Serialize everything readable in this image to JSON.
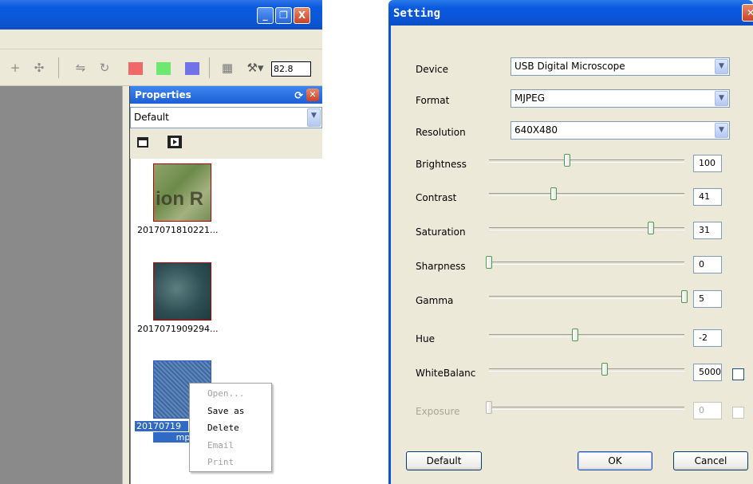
{
  "left_window": {
    "caption_buttons": {
      "minimize": "_",
      "restore": "❐",
      "close": "X"
    },
    "toolbar": {
      "tools": [
        "crosshair-tool",
        "move-tool",
        "flip-tool",
        "rotate-tool"
      ],
      "channel_colors": {
        "red": "#f06868",
        "green": "#6ee86e",
        "blue": "#7272e8"
      },
      "zoom_value": "82.8"
    },
    "properties": {
      "title": "Properties",
      "selected_option": "Default",
      "items": [
        {
          "caption": "2017071810221..."
        },
        {
          "caption": "2017071909294..."
        },
        {
          "caption_line1": "20170719  ",
          "caption_line2": "mp"
        }
      ]
    },
    "context_menu": {
      "open": "Open...",
      "save_as": "Save as",
      "delete": "Delete",
      "email": "Email",
      "print": "Print"
    }
  },
  "setting_dialog": {
    "title": "Setting",
    "device": {
      "label": "Device",
      "value": "USB Digital Microscope"
    },
    "format": {
      "label": "Format",
      "value": "MJPEG"
    },
    "resolution": {
      "label": "Resolution",
      "value": "640X480"
    },
    "sliders": {
      "brightness": {
        "label": "Brightness",
        "value": "100",
        "level": 0.4
      },
      "contrast": {
        "label": "Contrast",
        "value": "41",
        "level": 0.33
      },
      "saturation": {
        "label": "Saturation",
        "value": "31",
        "level": 0.83
      },
      "sharpness": {
        "label": "Sharpness",
        "value": "0",
        "level": 0.0
      },
      "gamma": {
        "label": "Gamma",
        "value": "5",
        "level": 1.0
      },
      "hue": {
        "label": "Hue",
        "value": "-2",
        "level": 0.44
      },
      "white_balance": {
        "label": "WhiteBalanc",
        "value": "5000",
        "level": 0.59
      },
      "exposure": {
        "label": "Exposure",
        "value": "0",
        "level": 0.0
      }
    },
    "buttons": {
      "default": "Default",
      "ok": "OK",
      "cancel": "Cancel"
    }
  },
  "colors": {
    "titlebar_blue": "#0a5ae0",
    "dialog_face": "#ece9d8",
    "close_red": "#c8432a"
  }
}
